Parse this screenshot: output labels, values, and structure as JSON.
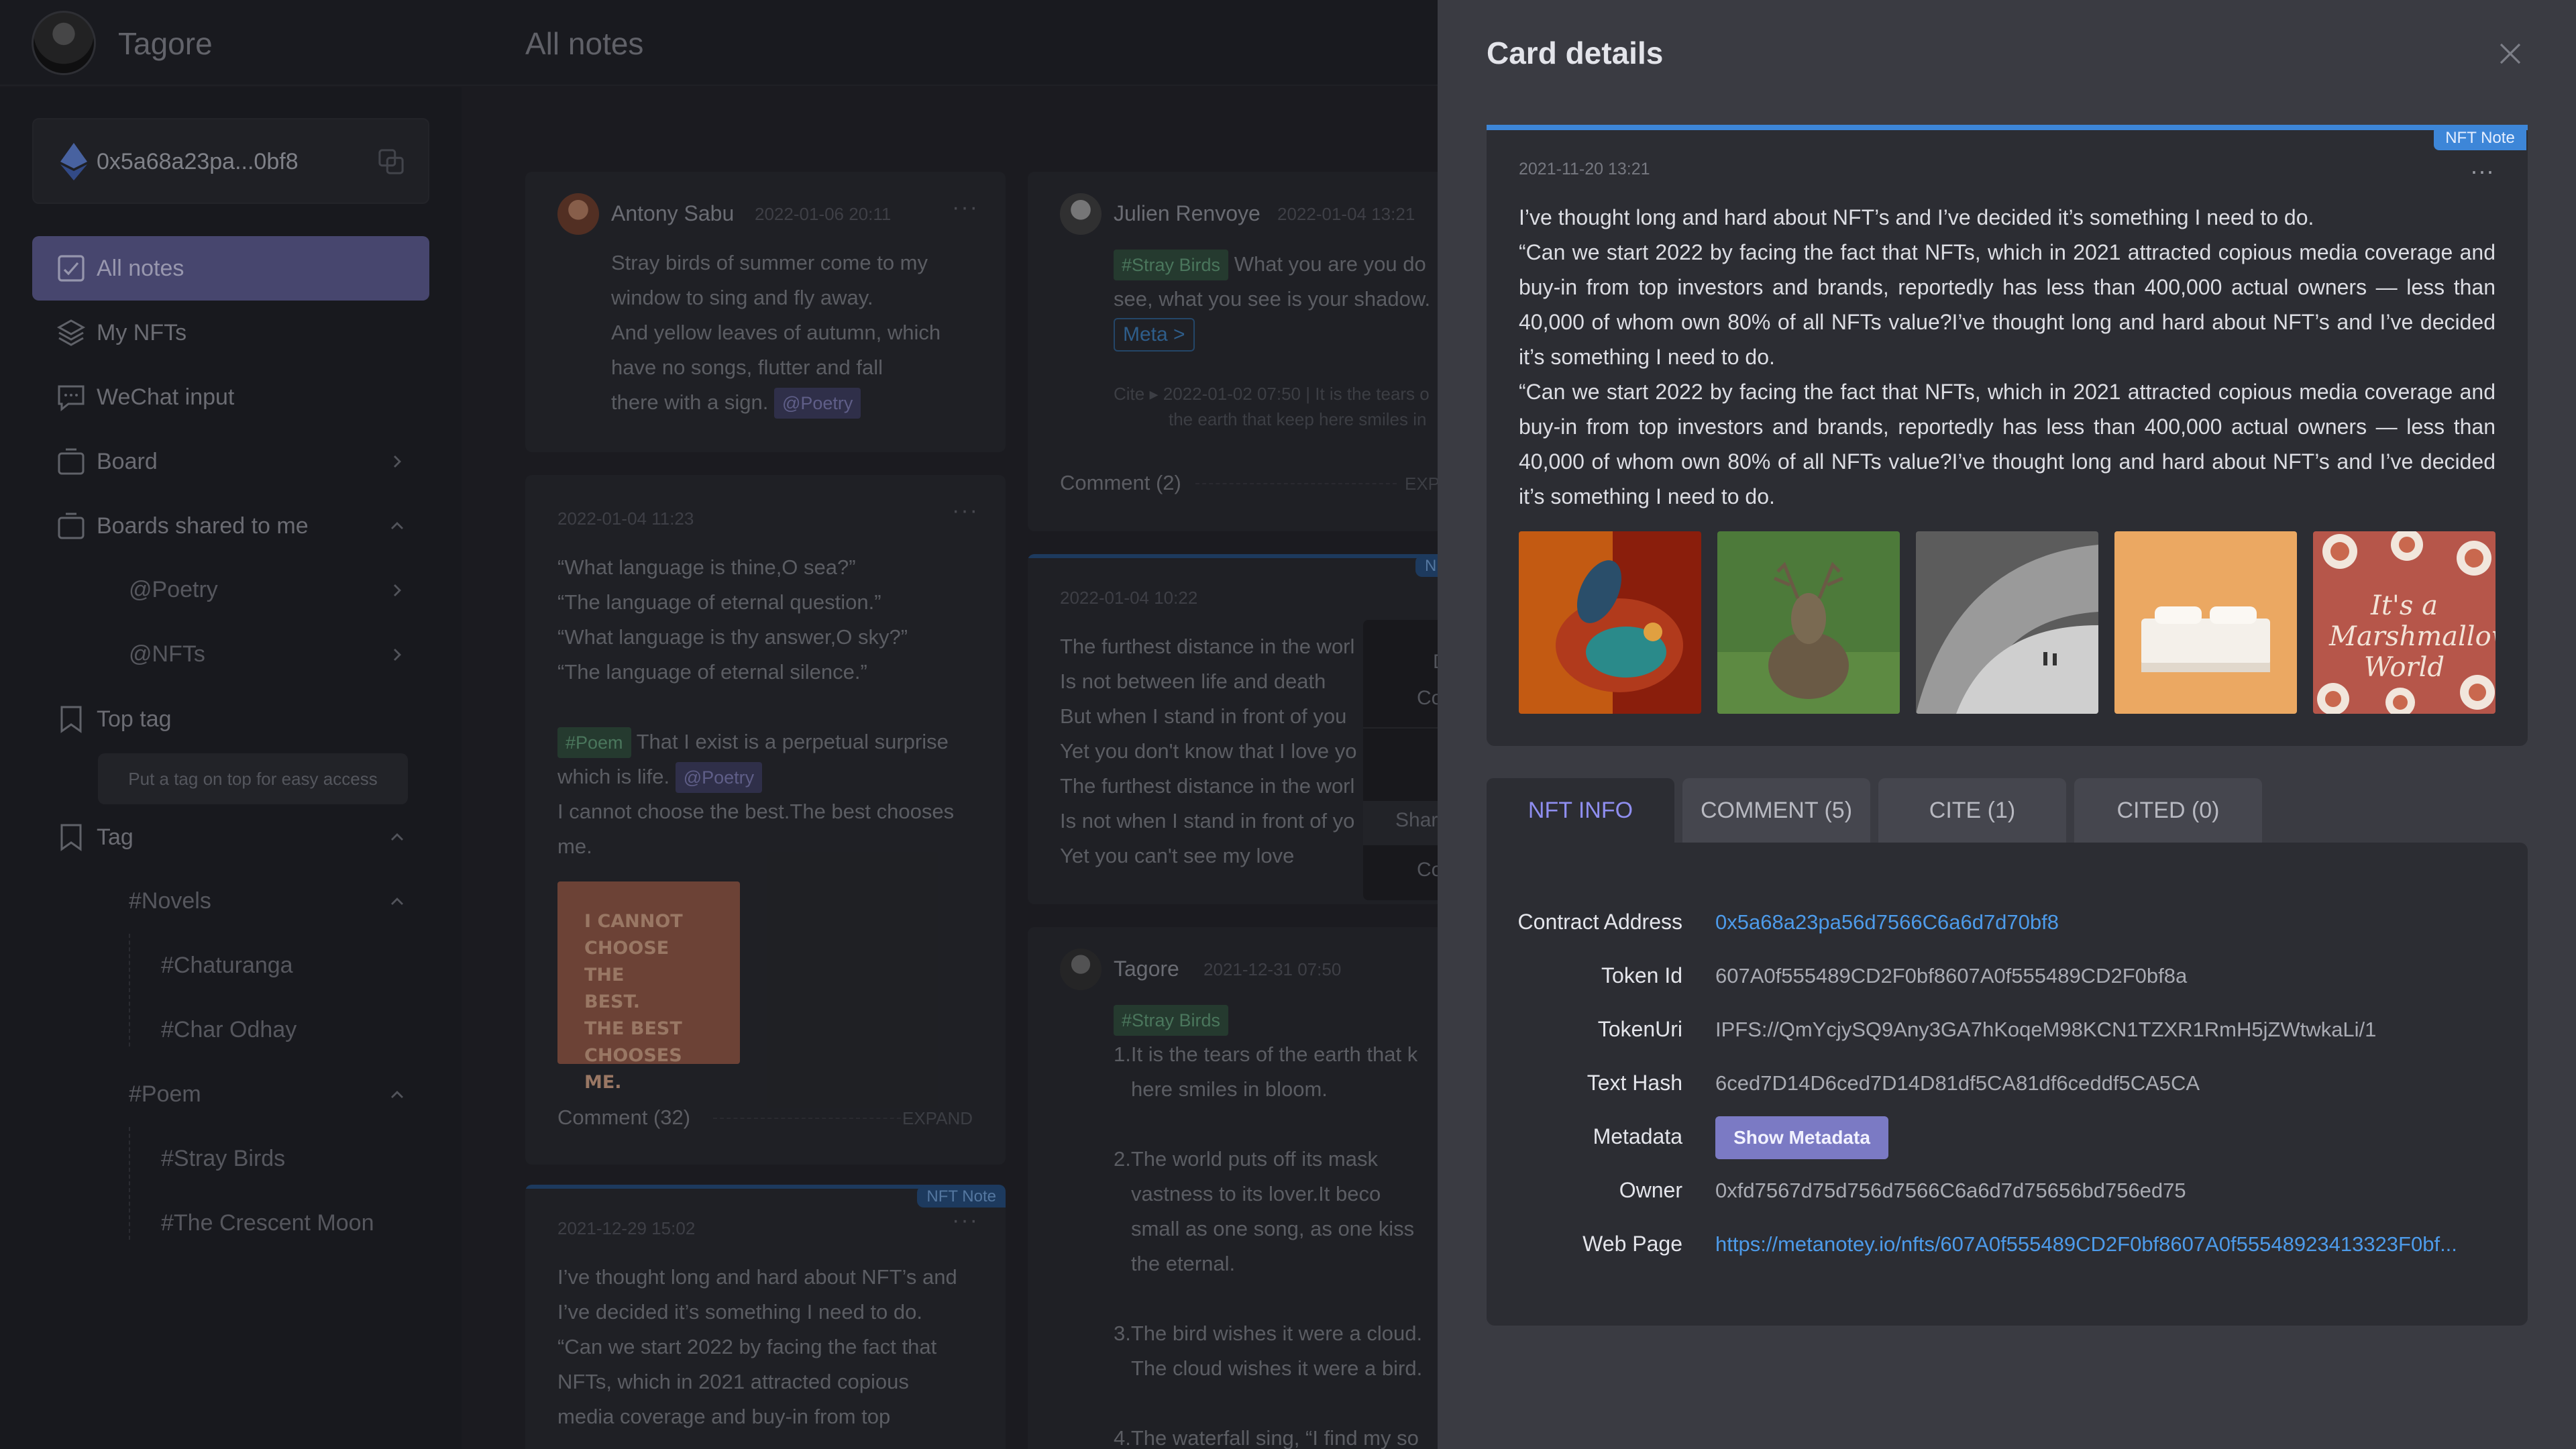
{
  "app": {
    "brand": "Tagore",
    "page_title": "All notes"
  },
  "wallet": {
    "address": "0x5a68a23pa...0bf8"
  },
  "sidebar": {
    "items": [
      {
        "label": "All notes"
      },
      {
        "label": "My NFTs"
      },
      {
        "label": "WeChat input"
      },
      {
        "label": "Board"
      },
      {
        "label": "Boards shared to me"
      },
      {
        "label": "Top tag"
      },
      {
        "label": "Tag"
      }
    ],
    "shared_boards": [
      "@Poetry",
      "@NFTs"
    ],
    "top_tag_hint": "Put a tag on top for easy access",
    "tags": {
      "novels": "#Novels",
      "novels_children": [
        "#Chaturanga",
        "#Char Odhay"
      ],
      "poem": "#Poem",
      "poem_children": [
        "#Stray Birds",
        "#The Crescent Moon"
      ]
    }
  },
  "cards": {
    "c1": {
      "author": "Antony Sabu",
      "date": "2022-01-06 20:11",
      "lines": [
        "Stray birds of summer come to my",
        "window to sing and fly away.",
        "And yellow leaves of autumn, which",
        "have no songs, flutter and fall",
        "there with a sign."
      ],
      "tag": "@Poetry"
    },
    "c2": {
      "date": "2022-01-04 11:23",
      "lines": [
        "“What language is thine,O sea?”",
        "“The language of eternal question.”",
        "“What language is thy answer,O sky?”",
        "“The language of eternal silence.”"
      ],
      "poem_tag": "#Poem",
      "poem_text_a": "That I exist is a perpetual surprise",
      "poem_text_b": "which is life.",
      "poetry_tag": "@Poetry",
      "line_c": "I cannot choose the best.The best chooses",
      "line_d": "me.",
      "image_lines": [
        "I CANNOT",
        "CHOOSE THE",
        "BEST.",
        "THE BEST",
        "CHOOSES ME."
      ],
      "comment": "Comment (32)",
      "expand": "EXPAND"
    },
    "c3": {
      "badge": "NFT Note",
      "date": "2021-12-29 15:02",
      "lines": [
        "I’ve thought long and hard about NFT’s and",
        "I’ve decided it’s something I need to do.",
        "“Can we start 2022 by facing the fact that",
        "NFTs, which in 2021 attracted copious",
        "media coverage and buy-in from top"
      ]
    },
    "c4": {
      "author": "Julien Renvoye",
      "date": "2022-01-04 13:21",
      "tag": "#Stray Birds",
      "text_a": "What you are you do",
      "text_b": "see, what you see is your shadow.",
      "meta": "Meta >",
      "cite_a": "Cite ▸ 2022-01-02 07:50 | It is the tears o",
      "cite_b": "the earth that keep here smiles in",
      "comment": "Comment (2)",
      "expand": "EXP"
    },
    "c5": {
      "badge": "N",
      "date": "2022-01-04 10:22",
      "lines": [
        "The furthest distance in the worl",
        "Is not between life and death",
        "But when I stand in front of you",
        "Yet you don't know that I love yo",
        "The furthest distance in the worl",
        "Is not when I stand in front of yo",
        "Yet you can't see my love"
      ],
      "menu": [
        "D",
        "Co",
        "Shar",
        "Co"
      ]
    },
    "c6": {
      "author": "Tagore",
      "date": "2021-12-31 07:50",
      "tag": "#Stray Birds",
      "lines": [
        "1.It is the tears of the earth that k",
        "here smiles in bloom.",
        "",
        "2.The world puts off its mask",
        "vastness to its lover.It beco",
        "small as one song, as one kiss",
        "the eternal.",
        "",
        "3.The bird wishes it were a cloud.",
        "The cloud wishes it were a bird.",
        "",
        "4.The waterfall sing, “I find my so"
      ]
    }
  },
  "drawer": {
    "title": "Card details",
    "badge": "NFT Note",
    "date": "2021-11-20 13:21",
    "body": "I’ve thought long and hard about NFT’s and I’ve decided it’s something I need to do.\n“Can we start 2022 by facing the fact that NFTs, which in 2021 attracted copious media coverage and buy-in from top investors and brands, reportedly has less than 400,000 actual owners — less than 40,000 of whom own 80% of all NFTs value?I’ve thought long and hard about NFT’s and I’ve decided it’s something I need to do.\n“Can we start 2022 by facing the fact that NFTs, which in 2021 attracted copious media coverage and buy-in from top investors and brands, reportedly has less than 400,000 actual owners — less than 40,000 of whom own 80% of all NFTs value?I’ve thought long and hard about NFT’s and I’ve decided it’s something I need to do.",
    "thumb5_text": "It's a Marshmallow World",
    "tabs": [
      "NFT INFO",
      "COMMENT (5)",
      "CITE (1)",
      "CITED (0)"
    ],
    "info": {
      "contract_label": "Contract Address",
      "contract": "0x5a68a23pa56d7566C6a6d7d70bf8",
      "token_id_label": "Token Id",
      "token_id": "607A0f555489CD2F0bf8607A0f555489CD2F0bf8a",
      "token_uri_label": "TokenUri",
      "token_uri": "IPFS://QmYcjySQ9Any3GA7hKoqeM98KCN1TZXR1RmH5jZWtwkaLi/1",
      "text_hash_label": "Text Hash",
      "text_hash": "6ced7D14D6ced7D14D81df5CA81df6ceddf5CA5CA",
      "metadata_label": "Metadata",
      "metadata_button": "Show Metadata",
      "owner_label": "Owner",
      "owner": "0xfd7567d75d756d7566C6a6d7d75656bd756ed75",
      "webpage_label": "Web Page",
      "webpage": "https://metanotey.io/nfts/607A0f555489CD2F0bf8607A0f55548923413323F0bf..."
    }
  }
}
